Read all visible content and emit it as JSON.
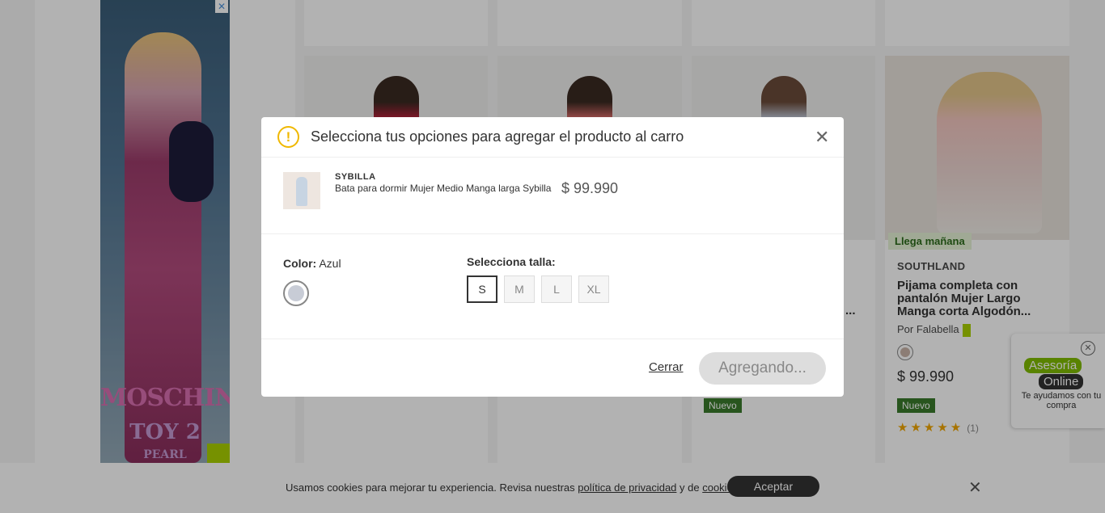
{
  "ad": {
    "close": "✕",
    "brand_line1": "MOSCHINO",
    "brand_line2": "TOY 2",
    "brand_line3": "PEARL"
  },
  "product_card": {
    "delivery_badge": "Llega mañana",
    "brand": "SOUTHLAND",
    "title": "Pijama completa con pantalón Mujer Largo Manga corta Algodón...",
    "seller": "Por Falabella",
    "price": "$ 99.990",
    "new_badge": "Nuevo",
    "stars": "★★★★★",
    "review_count": "(1)"
  },
  "card3": {
    "title_fragment": "...",
    "new_badge": "Nuevo"
  },
  "chat": {
    "close": "✕",
    "line1": "Asesoría",
    "line2": "Online",
    "help": "Te ayudamos con tu compra"
  },
  "cookie_bar": {
    "text_before": "Usamos cookies para mejorar tu experiencia. Revisa nuestras ",
    "privacy_link": "política de privacidad",
    "text_middle": " y de ",
    "cookies_link": "cookies",
    "text_after": ".",
    "accept_label": "Aceptar",
    "close": "✕"
  },
  "modal": {
    "warning_icon": "!",
    "title": "Selecciona tus opciones para agregar el producto al carro",
    "close": "✕",
    "product": {
      "brand": "SYBILLA",
      "name": "Bata para dormir Mujer Medio Manga larga Sybilla",
      "price": "$ 99.990"
    },
    "color": {
      "label": "Color:",
      "value": "Azul"
    },
    "size": {
      "label": "Selecciona talla:",
      "options": [
        "S",
        "M",
        "L",
        "XL"
      ],
      "selected": "S"
    },
    "cancel_label": "Cerrar",
    "adding_label": "Agregando..."
  },
  "colors": {
    "accent_green": "#aad000",
    "warning": "#f0b800",
    "star": "#f0a500"
  }
}
